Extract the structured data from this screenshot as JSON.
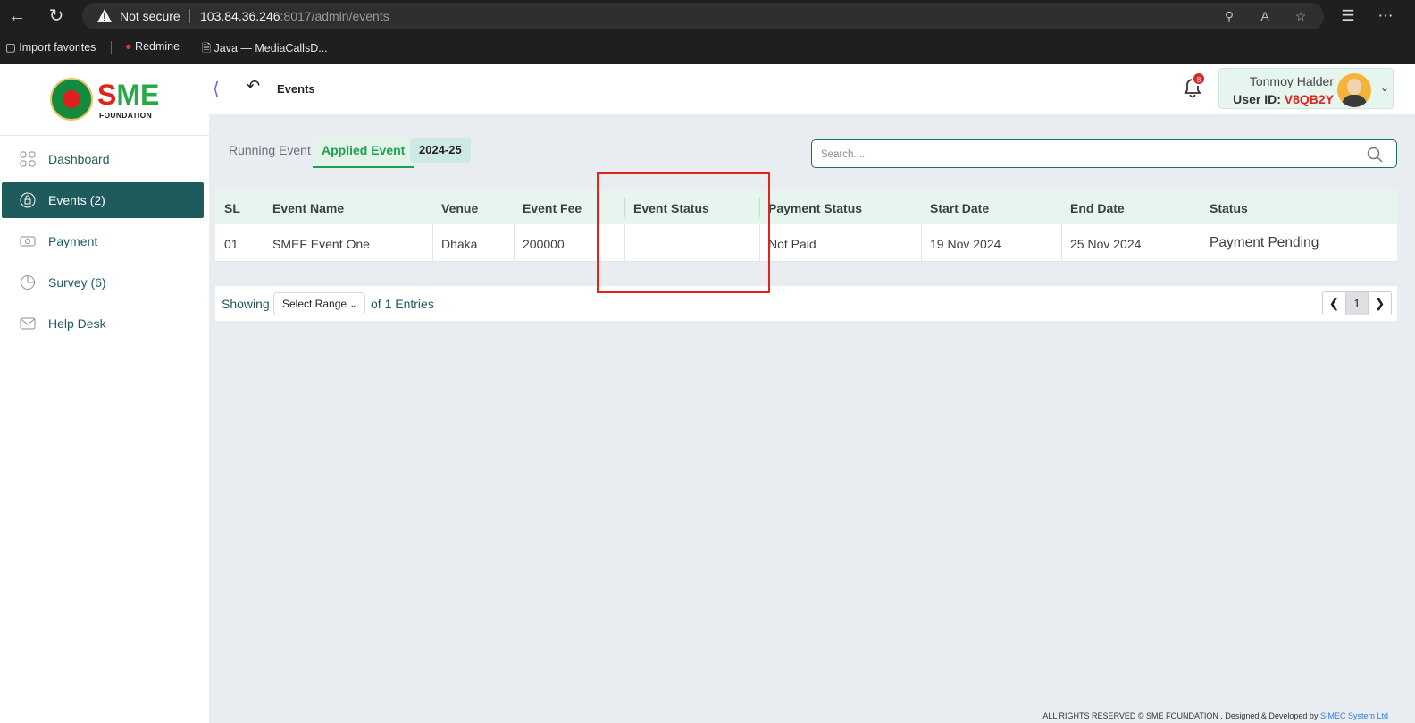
{
  "browser": {
    "security_label": "Not secure",
    "url_host": "103.84.36.246",
    "url_rest": ":8017/admin/events",
    "bookmarks": [
      "Import favorites",
      "Redmine",
      "Java — MediaCallsD..."
    ]
  },
  "sidebar": {
    "logo_text_s": "S",
    "logo_text_me": "ME",
    "logo_sub": "FOUNDATION",
    "items": [
      {
        "label": "Dashboard",
        "icon": "grid-icon"
      },
      {
        "label": "Events (2)",
        "icon": "events-icon"
      },
      {
        "label": "Payment",
        "icon": "payment-icon"
      },
      {
        "label": "Survey (6)",
        "icon": "survey-icon"
      },
      {
        "label": "Help Desk",
        "icon": "mail-icon"
      }
    ]
  },
  "header": {
    "breadcrumb": "Events",
    "notification_count": "8",
    "user_name": "Tonmoy Halder",
    "user_id_label": "User ID:",
    "user_id": "V8QB2Y"
  },
  "tabs": {
    "running": "Running Event",
    "applied": "Applied Event",
    "year": "2024-25"
  },
  "search": {
    "placeholder": "Search...."
  },
  "table": {
    "headers": [
      "SL",
      "Event Name",
      "Venue",
      "Event Fee",
      "Event Status",
      "Payment Status",
      "Start Date",
      "End Date",
      "Status"
    ],
    "rows": [
      {
        "sl": "01",
        "event_name": "SMEF Event One",
        "venue": "Dhaka",
        "event_fee": "200000",
        "event_status": "",
        "payment_status": "Not Paid",
        "start_date": "19 Nov 2024",
        "end_date": "25 Nov 2024",
        "status": "Payment Pending"
      }
    ]
  },
  "pagination": {
    "showing": "Showing",
    "range_select": "Select Range",
    "entries": "of 1 Entries",
    "current_page": "1"
  },
  "footer": {
    "rights": "ALL RIGHTS RESERVED © SME FOUNDATION . Designed & Developed by",
    "developer": "SIMEC System Ltd"
  },
  "colors": {
    "primary": "#1f5a5c",
    "accent_green": "#1aa34a",
    "alert_red": "#e2231a"
  }
}
